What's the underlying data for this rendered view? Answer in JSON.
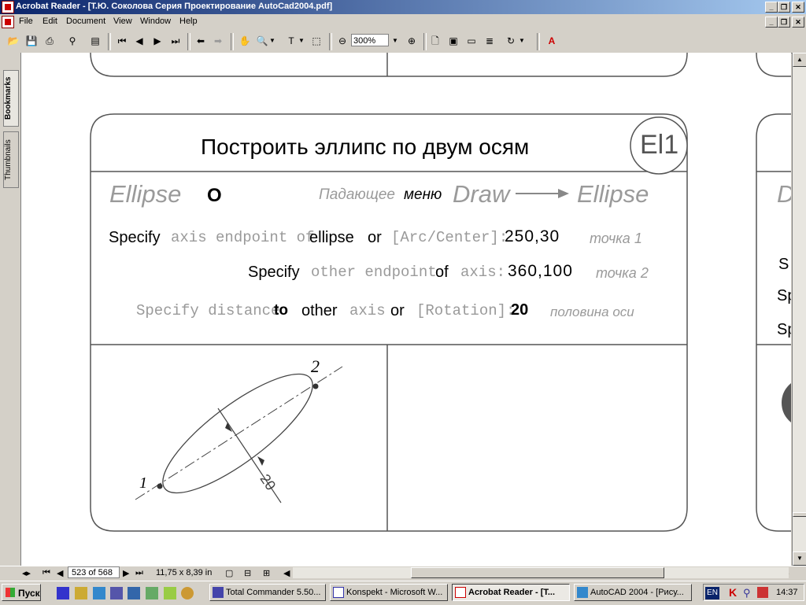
{
  "window": {
    "title": "Acrobat Reader - [Т.Ю. Соколова Серия Проектирование AutoCad2004.pdf]"
  },
  "menu": [
    "File",
    "Edit",
    "Document",
    "View",
    "Window",
    "Help"
  ],
  "toolbar": {
    "zoom": "300%"
  },
  "sidetabs": {
    "bookmarks": "Bookmarks",
    "thumbnails": "Thumbnails"
  },
  "doc": {
    "heading": "Построить эллипс по двум осям",
    "badge": "El1",
    "cmd": {
      "name": "Ellipse",
      "alias": "O",
      "menu_word1": "Падающее",
      "menu_word2": "меню",
      "draw": "Draw",
      "ellipse": "Ellipse"
    },
    "line1": {
      "a": "Specify",
      "b": "axis endpoint of",
      "c": "ellipse",
      "d": "or",
      "e": "[Arc/Center]:",
      "f": "250,30",
      "g": "точка 1"
    },
    "line2": {
      "a": "Specify",
      "b": "other endpoint",
      "c": "of",
      "d": "axis:",
      "e": "360,100",
      "f": "точка 2"
    },
    "line3": {
      "a": "Specify distance",
      "b": "to",
      "c": "other",
      "d": "axis",
      "e": "or",
      "f": "[Rotation]:",
      "g": "20",
      "h": "половина оси"
    },
    "figure": {
      "p1": "1",
      "p2": "2",
      "dim": "20"
    },
    "right_partial": {
      "d": "D",
      "s": "S",
      "sp1": "Sp",
      "sp2": "Sp"
    }
  },
  "status": {
    "page": "523 of 568",
    "size": "11,75 x 8,39 in"
  },
  "taskbar": {
    "start": "Пуск",
    "tasks": [
      {
        "label": "Total Commander 5.50...",
        "active": false
      },
      {
        "label": "Konspekt - Microsoft W...",
        "active": false
      },
      {
        "label": "Acrobat Reader - [Т...",
        "active": true
      },
      {
        "label": "AutoCAD 2004 - [Рису...",
        "active": false
      }
    ],
    "lang": "EN",
    "time": "14:37"
  }
}
